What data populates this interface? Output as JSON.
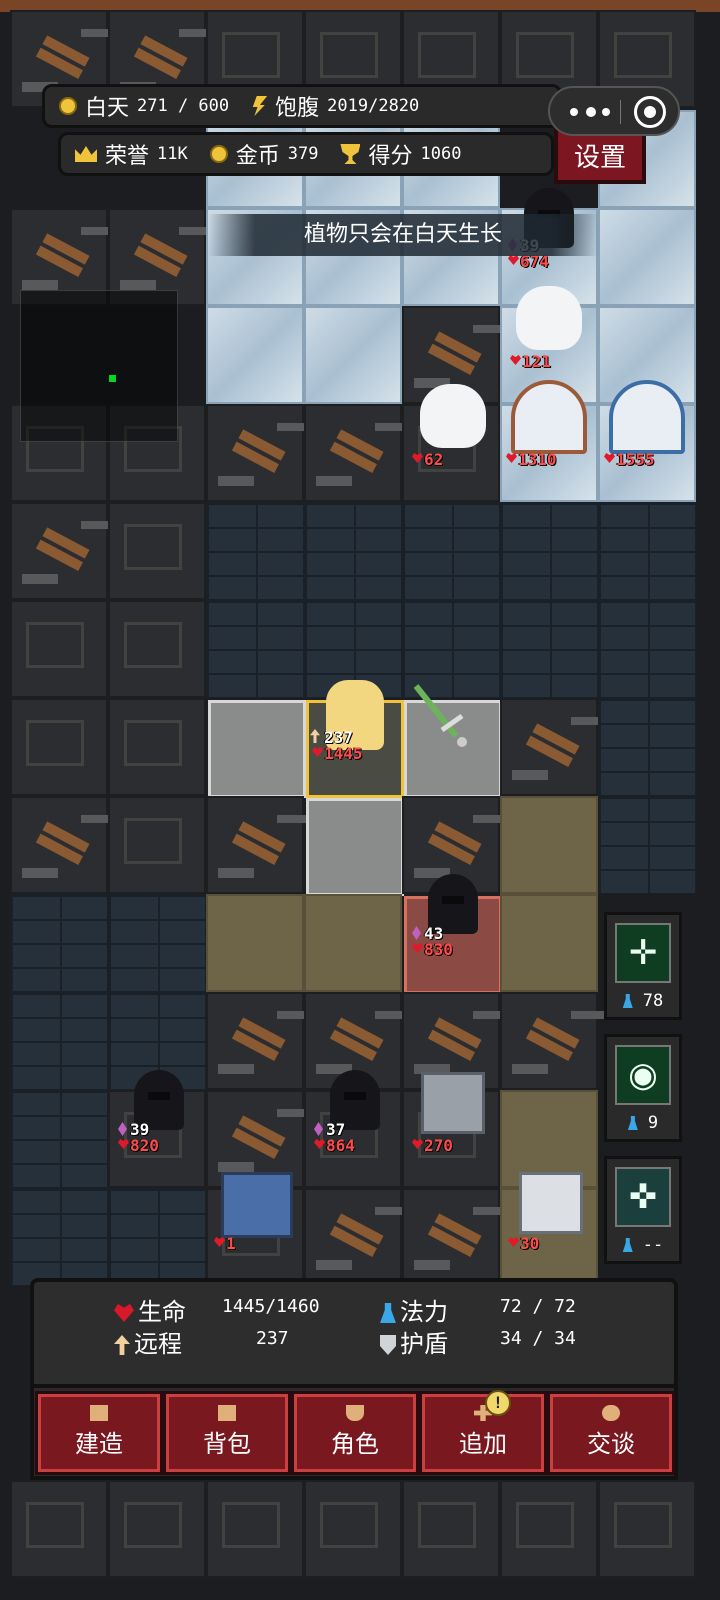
{
  "hud": {
    "day_label": "白天",
    "day_value": "271 / 600",
    "hunger_label": "饱腹",
    "hunger_value": "2019/2820",
    "honor_label": "荣誉",
    "honor_value": "11K",
    "gold_label": "金币",
    "gold_value": "379",
    "score_label": "得分",
    "score_value": "1060"
  },
  "settings_label": "设置",
  "toast": "植物只会在白天生长",
  "units": {
    "reaper_1": {
      "atk": "39",
      "hp": "674"
    },
    "yeti_1": {
      "hp": "121"
    },
    "yeti_2": {
      "hp": "62"
    },
    "igloo_1": {
      "hp": "1310"
    },
    "igloo_2": {
      "hp": "1555"
    },
    "hero": {
      "atk": "237",
      "hp": "1445"
    },
    "reaper_2": {
      "atk": "43",
      "hp": "830"
    },
    "reaper_3": {
      "atk": "39",
      "hp": "820"
    },
    "reaper_4": {
      "atk": "37",
      "hp": "864"
    },
    "machine_1": {
      "hp": "270"
    },
    "chest_1": {
      "hp": "1"
    },
    "machine_2": {
      "hp": "30"
    }
  },
  "skills": [
    {
      "icon": "holy-cross-icon",
      "cost": "78"
    },
    {
      "icon": "eye-icon",
      "cost": "9"
    },
    {
      "icon": "crosshair-icon",
      "cost": "--"
    }
  ],
  "status": {
    "hp_label": "生命",
    "hp_value": "1445/1460",
    "mana_label": "法力",
    "mana_value": "72 / 72",
    "ranged_label": "远程",
    "ranged_value": "237",
    "shield_label": "护盾",
    "shield_value": "34 / 34"
  },
  "actions": [
    {
      "label": "建造"
    },
    {
      "label": "背包"
    },
    {
      "label": "角色"
    },
    {
      "label": "追加",
      "badge": "!"
    },
    {
      "label": "交谈"
    }
  ],
  "colors": {
    "hp_red": "#ff4b4b",
    "accent_gold": "#f0c43a",
    "button_red": "#7a1820",
    "minimap_player": "#00d820"
  }
}
